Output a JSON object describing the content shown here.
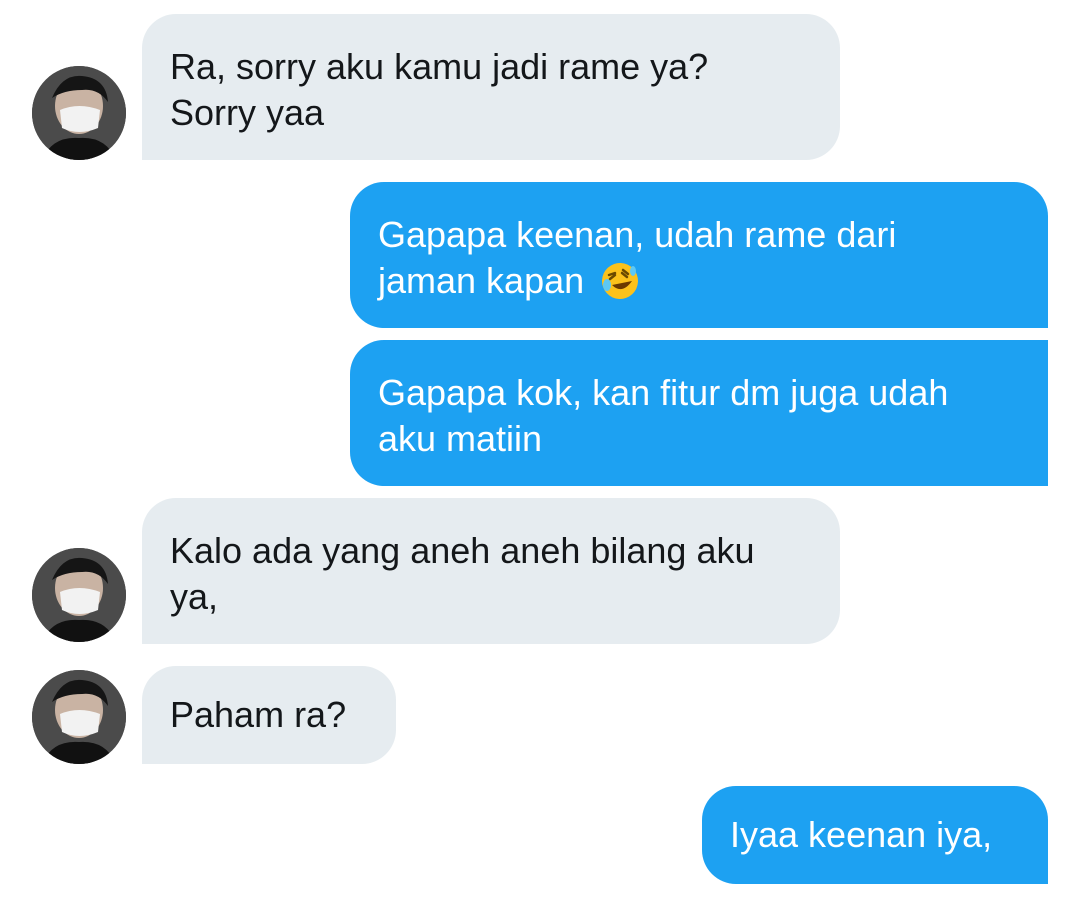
{
  "conversation": {
    "messages": [
      {
        "sender": "other",
        "lines": [
          "Ra, sorry aku kamu jadi rame ya?",
          "Sorry yaa"
        ]
      },
      {
        "sender": "me",
        "lines": [
          "Gapapa keenan, udah rame dari",
          "jaman kapan"
        ],
        "emoji": "rolling-on-floor-laughing-emoji"
      },
      {
        "sender": "me",
        "lines": [
          "Gapapa kok, kan fitur dm juga udah",
          "aku matiin"
        ]
      },
      {
        "sender": "other",
        "lines": [
          "Kalo ada yang aneh aneh bilang aku",
          "ya,"
        ]
      },
      {
        "sender": "other",
        "lines": [
          "Paham ra?"
        ]
      },
      {
        "sender": "me",
        "lines": [
          "Iyaa keenan iya,"
        ]
      }
    ]
  },
  "colors": {
    "received_bubble": "#e6ecf0",
    "sent_bubble": "#1da1f2",
    "received_text": "#14171a",
    "sent_text": "#ffffff"
  }
}
